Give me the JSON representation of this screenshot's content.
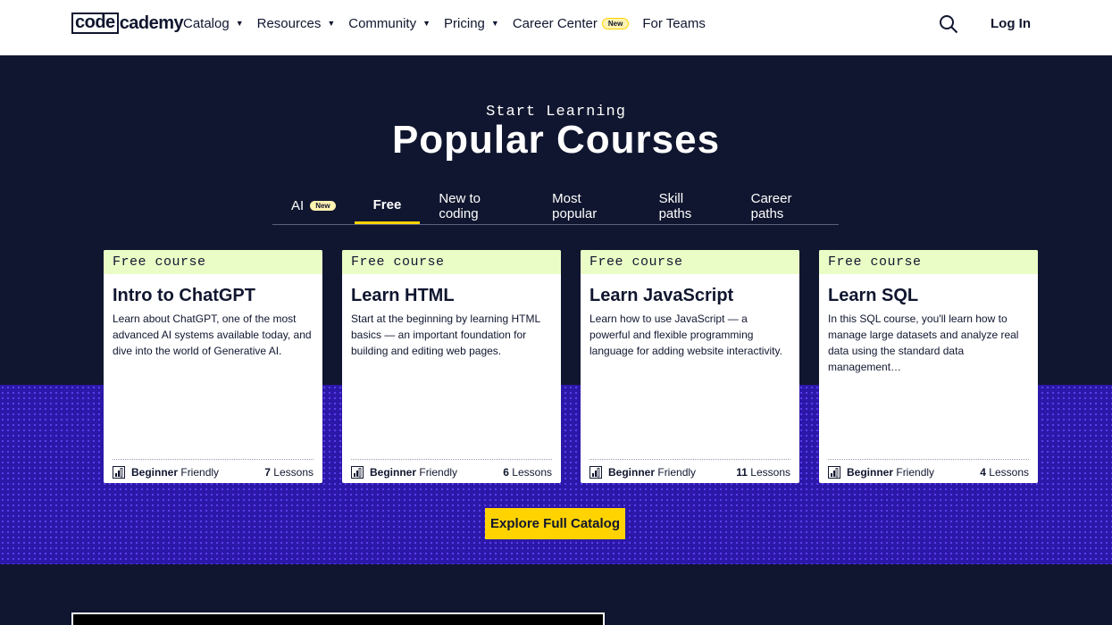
{
  "header": {
    "logo": {
      "boxed": "code",
      "rest": "cademy"
    },
    "nav": [
      {
        "label": "Catalog",
        "caret": true
      },
      {
        "label": "Resources",
        "caret": true
      },
      {
        "label": "Community",
        "caret": true
      },
      {
        "label": "Pricing",
        "caret": true
      },
      {
        "label": "Career Center",
        "badge": "New"
      },
      {
        "label": "For Teams"
      }
    ],
    "login": "Log In"
  },
  "hero": {
    "kicker": "Start Learning",
    "title": "Popular Courses"
  },
  "tabs": [
    {
      "label": "AI",
      "badge": "New",
      "active": false
    },
    {
      "label": "Free",
      "active": true
    },
    {
      "label": "New to coding",
      "active": false
    },
    {
      "label": "Most popular",
      "active": false
    },
    {
      "label": "Skill paths",
      "active": false
    },
    {
      "label": "Career paths",
      "active": false
    }
  ],
  "cards": [
    {
      "kind": "Free course",
      "title": "Intro to ChatGPT",
      "desc": "Learn about ChatGPT, one of the most advanced AI systems available today, and dive into the world of Generative AI.",
      "level_bold": "Beginner",
      "level_rest": "Friendly",
      "lessons_num": "7",
      "lessons_word": "Lessons"
    },
    {
      "kind": "Free course",
      "title": "Learn HTML",
      "desc": "Start at the beginning by learning HTML basics — an important foundation for building and editing web pages.",
      "level_bold": "Beginner",
      "level_rest": "Friendly",
      "lessons_num": "6",
      "lessons_word": "Lessons"
    },
    {
      "kind": "Free course",
      "title": "Learn JavaScript",
      "desc": "Learn how to use JavaScript — a powerful and flexible programming language for adding website interactivity.",
      "level_bold": "Beginner",
      "level_rest": "Friendly",
      "lessons_num": "11",
      "lessons_word": "Lessons"
    },
    {
      "kind": "Free course",
      "title": "Learn SQL",
      "desc": "In this SQL course, you'll learn how to manage large datasets and analyze real data using the standard data management…",
      "level_bold": "Beginner",
      "level_rest": "Friendly",
      "lessons_num": "4",
      "lessons_word": "Lessons"
    }
  ],
  "cta": "Explore Full Catalog",
  "colors": {
    "navy": "#10162f",
    "accent_yellow": "#ffd300",
    "card_header_green": "#eafdc6",
    "band_purple": "#2b18a8"
  },
  "icons": {
    "search": "search-icon",
    "level": "bar-chart-icon"
  }
}
